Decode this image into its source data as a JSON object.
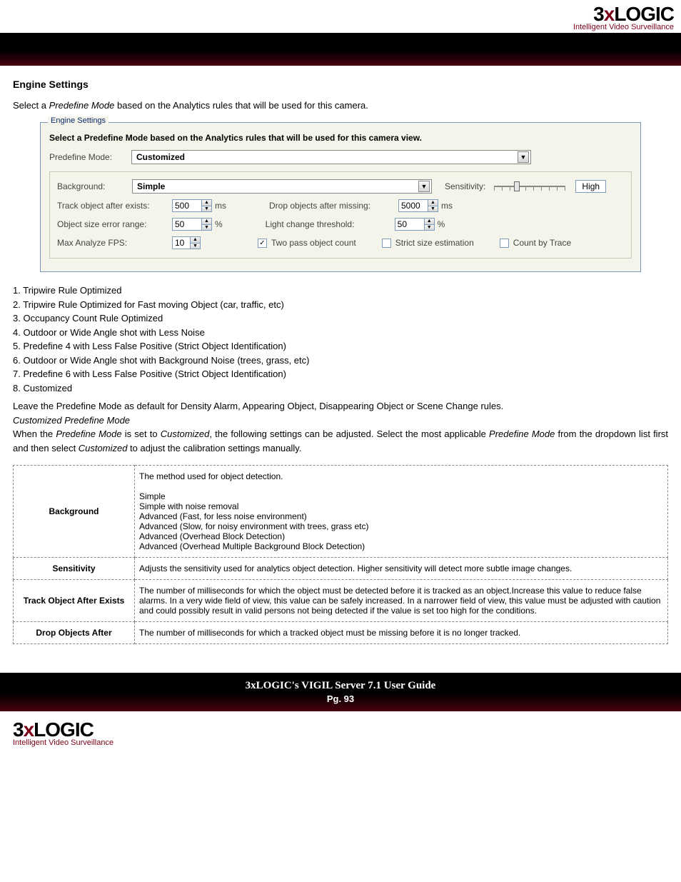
{
  "brand": {
    "three": "3",
    "x": "x",
    "logic": "LOGIC",
    "tag": "Intelligent Video Surveillance"
  },
  "section_title": "Engine Settings",
  "intro": {
    "pre": "Select a ",
    "em": "Predefine Mode",
    "post": " based on the Analytics rules that will be used for this camera."
  },
  "dialog": {
    "legend": "Engine Settings",
    "instruction": "Select a Predefine Mode based on the Analytics rules that will be used for this camera view.",
    "predefine_label": "Predefine Mode:",
    "predefine_value": "Customized",
    "background_label": "Background:",
    "background_value": "Simple",
    "sensitivity_label": "Sensitivity:",
    "sensitivity_badge": "High",
    "track_exists_label": "Track object after exists:",
    "track_exists_value": "500",
    "track_exists_unit": "ms",
    "drop_missing_label": "Drop objects after missing:",
    "drop_missing_value": "5000",
    "drop_missing_unit": "ms",
    "obj_size_label": "Object size error range:",
    "obj_size_value": "50",
    "obj_size_unit": "%",
    "light_label": "Light change threshold:",
    "light_value": "50",
    "light_unit": "%",
    "fps_label": "Max Analyze FPS:",
    "fps_value": "10",
    "chk_two_pass": "Two pass object count",
    "chk_strict": "Strict size estimation",
    "chk_trace": "Count by Trace"
  },
  "modes": [
    "1. Tripwire Rule Optimized",
    "2. Tripwire Rule Optimized for Fast moving Object (car, traffic, etc)",
    "3. Occupancy Count Rule Optimized",
    "4. Outdoor or Wide Angle shot with Less Noise",
    "5. Predefine 4 with Less False Positive (Strict Object Identification)",
    "6. Outdoor or Wide Angle shot with Background Noise (trees, grass, etc)",
    "7. Predefine 6 with Less False Positive (Strict Object Identification)",
    "8. Customized"
  ],
  "after": {
    "leave": "Leave the Predefine Mode as default for Density Alarm, Appearing Object, Disappearing Object or Scene Change rules.",
    "custom_head": "Customized Predefine Mode",
    "p1a": "When the ",
    "p1b": "Predefine Mode",
    "p1c": " is set to ",
    "p1d": "Customized",
    "p1e": ", the following settings can be adjusted.  Select the most applicable ",
    "p2a": "Predefine Mode",
    "p2b": " from the dropdown list first and then select ",
    "p2c": "Customized",
    "p2d": " to adjust the calibration settings manually."
  },
  "table": {
    "background_key": "Background",
    "background_intro": "The method used for object detection.",
    "background_opts": [
      "Simple",
      "Simple with noise removal",
      "Advanced (Fast, for less noise environment)",
      "Advanced (Slow, for noisy environment with trees, grass etc)",
      "Advanced (Overhead Block Detection)",
      "Advanced (Overhead Multiple Background Block Detection)"
    ],
    "sensitivity_key": "Sensitivity",
    "sensitivity_val": "Adjusts the sensitivity used for analytics object detection. Higher sensitivity will detect more subtle image changes.",
    "track_key": "Track Object After Exists",
    "track_val": "The number of milliseconds for which the object must be detected before it is tracked as an object.Increase this value to reduce false alarms.  In a very wide field of view, this value can be safely increased. In a narrower field of view, this value must be adjusted with caution and could possibly result in valid persons not being detected if the value is set too high for the conditions.",
    "drop_key": "Drop Objects After",
    "drop_val": "The number of milliseconds for which a tracked object must be missing before it is no longer tracked."
  },
  "footer": {
    "title": "3xLOGIC's VIGIL Server 7.1 User Guide",
    "page": "Pg. 93"
  }
}
